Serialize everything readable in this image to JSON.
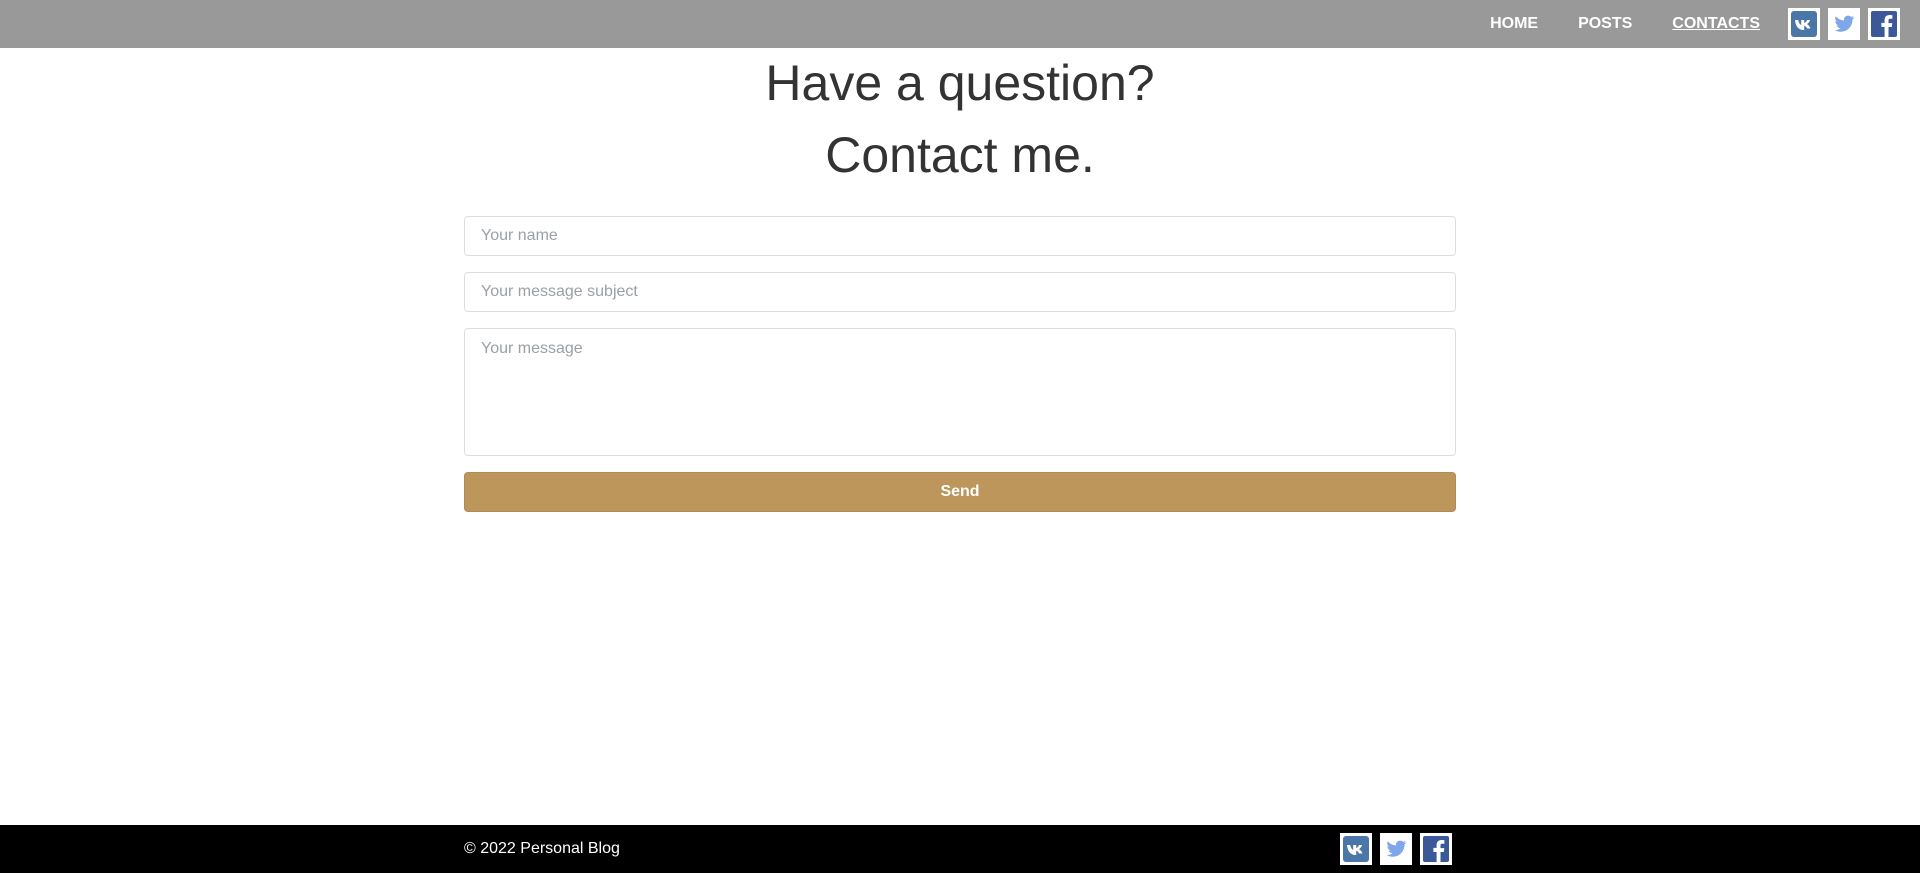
{
  "nav": {
    "items": [
      {
        "label": "HOME"
      },
      {
        "label": "POSTS"
      },
      {
        "label": "CONTACTS"
      }
    ]
  },
  "heading": {
    "line1": "Have a question?",
    "line2": "Contact me."
  },
  "form": {
    "name_placeholder": "Your name",
    "subject_placeholder": "Your message subject",
    "message_placeholder": "Your message",
    "send_label": "Send"
  },
  "footer": {
    "copyright": "© 2022 Personal Blog"
  },
  "social": [
    {
      "icon": "vk-icon"
    },
    {
      "icon": "twitter-icon"
    },
    {
      "icon": "facebook-icon"
    }
  ],
  "colors": {
    "topbar": "#999999",
    "accent": "#bd965c",
    "vk": "#4a76a8",
    "twitter": "#7ea6e8",
    "facebook": "#3b5998",
    "footer": "#000000"
  }
}
